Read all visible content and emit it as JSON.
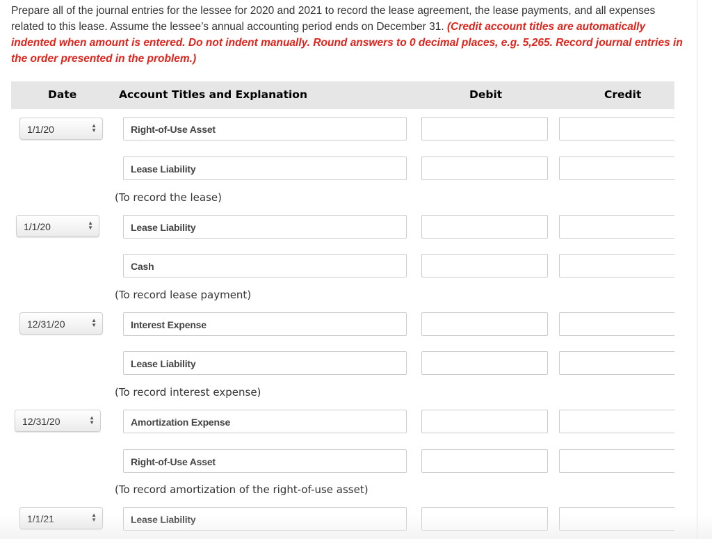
{
  "instructions": {
    "text": "Prepare all of the journal entries for the lessee for 2020 and 2021 to record the lease agreement, the lease payments, and all expenses related to this lease. Assume the lessee’s annual accounting period ends on December 31. ",
    "note": "(Credit account titles are automatically indented when amount is entered. Do not indent manually. Round answers to 0 decimal places, e.g. 5,265. Record journal entries in the order presented in the problem.)"
  },
  "table": {
    "headers": {
      "date": "Date",
      "account": "Account Titles and Explanation",
      "debit": "Debit",
      "credit": "Credit"
    },
    "entries": [
      {
        "date": "1/1/20",
        "lines": [
          {
            "account": "Right-of-Use Asset",
            "debit": "",
            "credit": ""
          },
          {
            "account": "Lease Liability",
            "debit": "",
            "credit": ""
          }
        ],
        "explanation": "(To record the lease)"
      },
      {
        "date": "1/1/20",
        "lines": [
          {
            "account": "Lease Liability",
            "debit": "",
            "credit": ""
          },
          {
            "account": "Cash",
            "debit": "",
            "credit": ""
          }
        ],
        "explanation": "(To record lease payment)"
      },
      {
        "date": "12/31/20",
        "lines": [
          {
            "account": "Interest Expense",
            "debit": "",
            "credit": ""
          },
          {
            "account": "Lease Liability",
            "debit": "",
            "credit": ""
          }
        ],
        "explanation": "(To record interest expense)"
      },
      {
        "date": "12/31/20",
        "lines": [
          {
            "account": "Amortization Expense",
            "debit": "",
            "credit": ""
          },
          {
            "account": "Right-of-Use Asset",
            "debit": "",
            "credit": ""
          }
        ],
        "explanation": "(To record amortization of the right-of-use asset)"
      },
      {
        "date": "1/1/21",
        "lines": [
          {
            "account": "Lease Liability",
            "debit": "",
            "credit": ""
          }
        ],
        "explanation": ""
      }
    ]
  }
}
